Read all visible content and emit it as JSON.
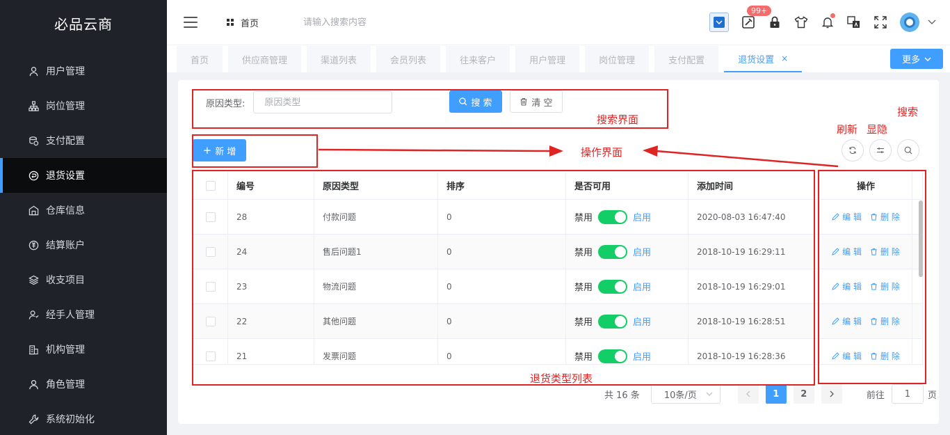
{
  "sidebar": {
    "brand": "必品云商",
    "items": [
      {
        "label": "用户管理",
        "icon": "user-icon"
      },
      {
        "label": "岗位管理",
        "icon": "org-tree-icon"
      },
      {
        "label": "支付配置",
        "icon": "coins-icon"
      },
      {
        "label": "退货设置",
        "icon": "return-icon",
        "active": true
      },
      {
        "label": "仓库信息",
        "icon": "warehouse-icon"
      },
      {
        "label": "结算账户",
        "icon": "settlement-icon"
      },
      {
        "label": "收支项目",
        "icon": "layers-icon"
      },
      {
        "label": "经手人管理",
        "icon": "handler-icon"
      },
      {
        "label": "机构管理",
        "icon": "building-icon"
      },
      {
        "label": "角色管理",
        "icon": "role-icon"
      },
      {
        "label": "系统初始化",
        "icon": "wrench-icon"
      }
    ]
  },
  "header": {
    "breadcrumb_home": "首页",
    "search_placeholder": "请输入搜索内容",
    "badge_count": "99+",
    "accent_color": "#409eff"
  },
  "tabs": {
    "items": [
      "首页",
      "供应商管理",
      "渠道列表",
      "会员列表",
      "往来客户",
      "用户管理",
      "岗位管理",
      "支付配置"
    ],
    "active": "退货设置",
    "active_close": "×",
    "more_label": "更多"
  },
  "search": {
    "label": "原因类型:",
    "placeholder": "原因类型",
    "search_button": "搜 索",
    "clear_button": "清 空"
  },
  "toolbar": {
    "add_button": "新 增"
  },
  "table": {
    "headers": {
      "id": "编号",
      "type": "原因类型",
      "sort": "排序",
      "enabled": "是否可用",
      "added": "添加时间",
      "ops": "操作"
    },
    "switch_off_label": "禁用",
    "switch_on_label": "启用",
    "edit_label": "编 辑",
    "delete_label": "删 除",
    "rows": [
      {
        "id": "28",
        "type": "付款问题",
        "sort": "0",
        "added": "2020-08-03 16:47:40"
      },
      {
        "id": "24",
        "type": "售后问题1",
        "sort": "0",
        "added": "2018-10-19 16:29:11"
      },
      {
        "id": "23",
        "type": "物流问题",
        "sort": "0",
        "added": "2018-10-19 16:29:01"
      },
      {
        "id": "22",
        "type": "其他问题",
        "sort": "0",
        "added": "2018-10-19 16:28:51"
      },
      {
        "id": "21",
        "type": "发票问题",
        "sort": "0",
        "added": "2018-10-19 16:28:36"
      }
    ]
  },
  "pagination": {
    "total": "共 16 条",
    "page_size": "10条/页",
    "pages": [
      "1",
      "2"
    ],
    "current": "1",
    "goto_prefix": "前往",
    "goto_value": "1",
    "goto_suffix": "页"
  },
  "annotations": {
    "search_area": "搜索界面",
    "ops_area": "操作界面",
    "refresh": "刷新",
    "toggle": "显隐",
    "search": "搜索",
    "list_area": "退货类型列表",
    "color": "#e02424"
  }
}
